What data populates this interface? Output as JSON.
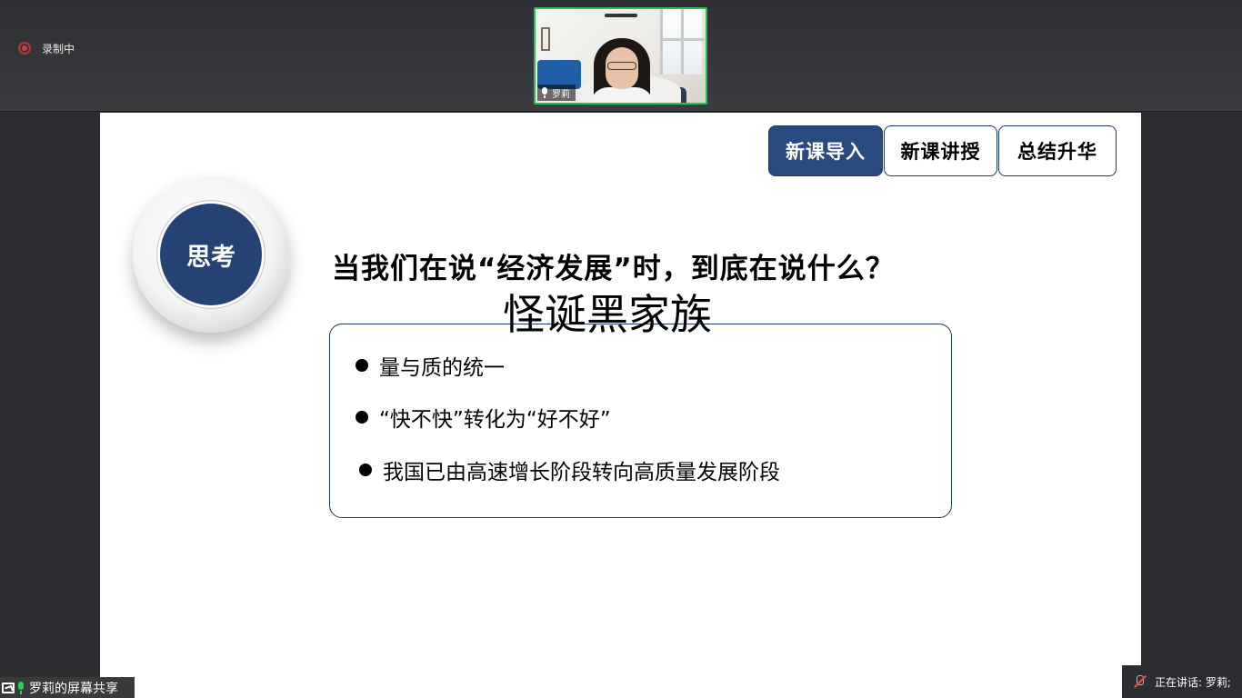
{
  "meeting": {
    "recording_label": "录制中",
    "participant_name": "罗莉",
    "share_label": "罗莉的屏幕共享",
    "speaking_label": "正在讲话: 罗莉;"
  },
  "slide": {
    "tabs": [
      {
        "label": "新课导入",
        "active": true
      },
      {
        "label": "新课讲授",
        "active": false
      },
      {
        "label": "总结升华",
        "active": false
      }
    ],
    "badge": "思考",
    "question": "当我们在说“经济发展”时，到底在说什么？",
    "overlay_title": "怪诞黑家族",
    "points": [
      "量与质的统一",
      "“快不快”转化为“好不好”",
      "我国已由高速增长阶段转向高质量发展阶段"
    ]
  },
  "colors": {
    "accent": "#2a4a7f",
    "active_speaker_border": "#27c24c",
    "recording_dot": "#d04040"
  }
}
